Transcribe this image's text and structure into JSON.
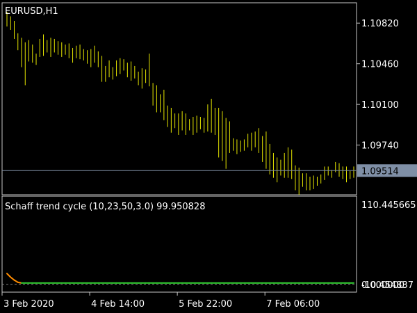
{
  "window": {
    "symbol_label": "EURUSD,H1"
  },
  "colors": {
    "background": "#000000",
    "frame": "#c8c8c8",
    "text": "#ffffff",
    "price_bars": "#e6e600",
    "bid_line": "#7f8fa6",
    "price_badge_bg": "#7f8fa6",
    "price_badge_text": "#000000",
    "stc_up": "#32c832",
    "stc_down": "#ff8c00",
    "stc_zero_line": "#808080"
  },
  "chart_data": [
    {
      "type": "ohlc",
      "title": "EURUSD,H1",
      "ylim": [
        1.093,
        1.11
      ],
      "yticks": [
        "1.10820",
        "1.10460",
        "1.10100",
        "1.09740"
      ],
      "yticks_values": [
        1.1082,
        1.1046,
        1.101,
        1.0974
      ],
      "current_price_label": "1.09514",
      "current_price": 1.09514,
      "x_ticks": [
        "3 Feb 2020",
        "4 Feb 14:00",
        "5 Feb 22:00",
        "7 Feb 06:00"
      ],
      "x_tick_bar_index": [
        0,
        24,
        48,
        72
      ],
      "bar_count": 96,
      "highs": [
        1.1092,
        1.1088,
        1.1084,
        1.1073,
        1.1069,
        1.1065,
        1.1067,
        1.1063,
        1.1055,
        1.1068,
        1.1072,
        1.1067,
        1.1069,
        1.1068,
        1.1066,
        1.1065,
        1.1063,
        1.1064,
        1.106,
        1.1062,
        1.1063,
        1.1059,
        1.1058,
        1.1059,
        1.1062,
        1.1057,
        1.1053,
        1.1044,
        1.1049,
        1.1043,
        1.1049,
        1.1051,
        1.105,
        1.1047,
        1.1048,
        1.1044,
        1.1039,
        1.1042,
        1.1041,
        1.1055,
        1.1029,
        1.1027,
        1.1019,
        1.1023,
        1.1009,
        1.1007,
        1.1002,
        1.1002,
        1.1004,
        1.1002,
        1.0997,
        1.0999,
        1.1,
        1.0999,
        1.0998,
        1.101,
        1.1015,
        1.1007,
        1.1007,
        1.1004,
        1.0998,
        1.0995,
        1.098,
        1.0979,
        1.0978,
        1.0979,
        1.0984,
        1.0985,
        1.0986,
        1.0989,
        1.0982,
        1.0986,
        1.0975,
        1.0967,
        1.0963,
        1.0961,
        1.0967,
        1.0972,
        1.097,
        1.0956,
        1.0954,
        1.0949,
        1.0949,
        1.0946,
        1.0947,
        1.0946,
        1.0948,
        1.0955,
        1.0955,
        1.0952,
        1.0959,
        1.0958,
        1.0955,
        1.0955,
        1.0951,
        1.0955
      ],
      "lows": [
        1.1079,
        1.1076,
        1.1068,
        1.1058,
        1.1043,
        1.1027,
        1.1048,
        1.1047,
        1.1045,
        1.1052,
        1.1053,
        1.1056,
        1.1052,
        1.1056,
        1.1054,
        1.1052,
        1.1054,
        1.1051,
        1.1047,
        1.1051,
        1.105,
        1.1049,
        1.1046,
        1.1043,
        1.1047,
        1.1043,
        1.103,
        1.103,
        1.1034,
        1.1032,
        1.1035,
        1.1037,
        1.104,
        1.1034,
        1.1031,
        1.1033,
        1.1027,
        1.1024,
        1.1029,
        1.1026,
        1.1009,
        1.1003,
        1.1003,
        1.0996,
        1.099,
        1.0985,
        1.0989,
        1.0983,
        1.0987,
        1.0983,
        1.0987,
        1.0983,
        1.0985,
        1.0988,
        1.0985,
        1.0986,
        1.0985,
        1.0983,
        1.0963,
        1.096,
        1.0953,
        1.0967,
        1.0969,
        1.0966,
        1.0968,
        1.0969,
        1.0972,
        1.0969,
        1.0972,
        1.0967,
        1.0959,
        1.0953,
        1.0948,
        1.0945,
        1.0941,
        1.0947,
        1.0945,
        1.0945,
        1.0944,
        1.0934,
        1.093,
        1.0937,
        1.0934,
        1.0934,
        1.0935,
        1.0938,
        1.094,
        1.0943,
        1.0947,
        1.0945,
        1.095,
        1.0946,
        1.0944,
        1.0941,
        1.0944,
        1.0945
      ]
    },
    {
      "type": "line",
      "title": "Schaff trend cycle (10,23,50,3.0) 99.950828",
      "ylim": [
        -1.0,
        110.445665
      ],
      "yticks_labels": [
        "110.445665",
        "0.000000",
        "-10.454837"
      ],
      "current_value": 99.950828,
      "values": [
        14,
        9,
        5,
        2,
        1,
        1,
        1,
        1,
        1,
        1,
        1,
        1,
        1,
        1,
        1,
        1,
        1,
        1,
        1,
        1,
        1,
        1,
        1,
        1,
        1,
        1,
        1,
        1,
        1,
        1,
        1,
        1,
        1,
        1,
        1,
        1,
        1,
        1,
        1,
        1,
        1,
        1,
        1,
        1,
        1,
        1,
        1,
        1,
        1,
        1,
        1,
        1,
        1,
        1,
        1,
        1,
        1,
        1,
        1,
        1,
        1,
        1,
        1,
        1,
        1,
        1,
        1,
        1,
        1,
        1,
        1,
        1,
        1,
        1,
        1,
        1,
        1,
        1,
        1,
        1,
        1,
        1,
        1,
        1,
        1,
        1,
        1,
        1,
        1,
        1,
        1,
        1,
        1,
        1,
        1,
        1
      ]
    }
  ]
}
